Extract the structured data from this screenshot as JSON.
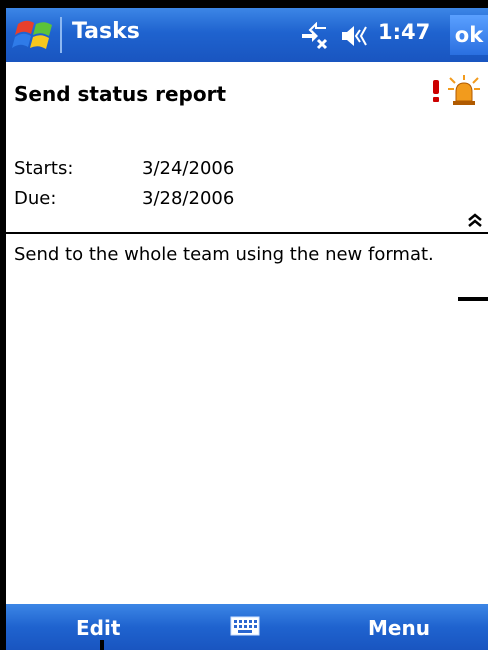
{
  "titlebar": {
    "app_title": "Tasks",
    "clock": "1:47",
    "ok_label": "ok"
  },
  "task": {
    "subject": "Send status report",
    "starts_label": "Starts:",
    "starts_value": "3/24/2006",
    "due_label": "Due:",
    "due_value": "3/28/2006",
    "notes": "Send to the whole team using the new format."
  },
  "menubar": {
    "left_label": "Edit",
    "right_label": "Menu"
  },
  "icons": {
    "start": "windows-flag-icon",
    "connectivity": "connectivity-icon",
    "volume": "speaker-icon",
    "priority": "high-priority-icon",
    "reminder": "reminder-alarm-icon",
    "collapse": "collapse-chevron-icon",
    "keyboard": "keyboard-icon"
  },
  "colors": {
    "bar_blue": "#1f63cf",
    "priority_red": "#cc0000",
    "alarm_orange": "#f29b1d"
  }
}
